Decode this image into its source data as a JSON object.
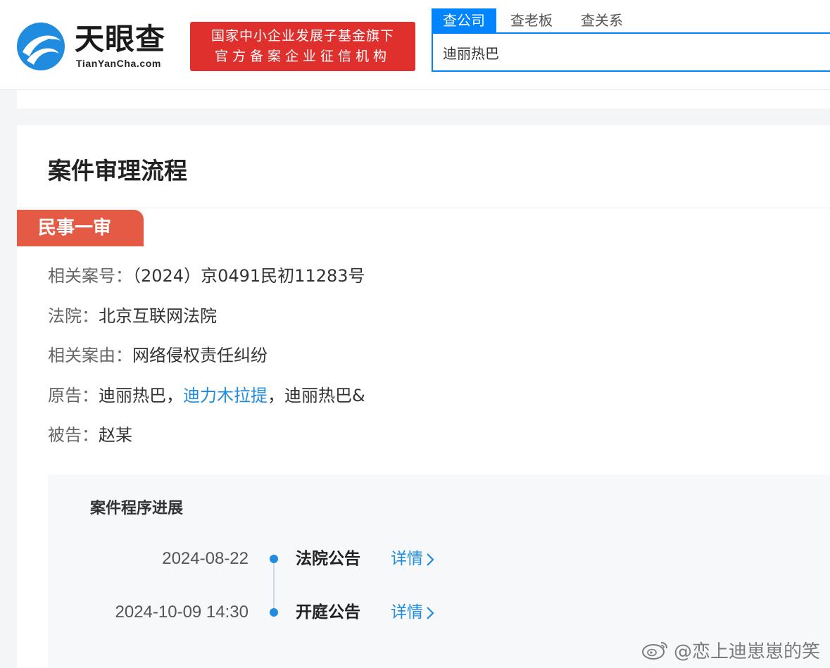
{
  "header": {
    "logo_name": "天眼查",
    "logo_domain": "TianYanCha.com",
    "badge_line1": "国家中小企业发展子基金旗下",
    "badge_line2": "官方备案企业征信机构",
    "tabs": [
      {
        "label": "查公司",
        "active": true
      },
      {
        "label": "查老板",
        "active": false
      },
      {
        "label": "查关系",
        "active": false
      }
    ],
    "search_value": "迪丽热巴",
    "accent_color": "#0084ff",
    "badge_color": "#e0302d"
  },
  "case": {
    "title": "案件审理流程",
    "stage": "民事一审",
    "stage_color": "#e45a45",
    "case_no_label": "相关案号：",
    "case_no": "（2024）京0491民初11283号",
    "court_label": "法院：",
    "court": "北京互联网法院",
    "cause_label": "相关案由：",
    "cause": "网络侵权责任纠纷",
    "plaintiff_label": "原告：",
    "plaintiffs": [
      {
        "name": "迪丽热巴",
        "sep": "，"
      },
      {
        "name": "迪力木拉提",
        "sep": "，"
      },
      {
        "name": "迪丽热巴&",
        "sep": ""
      }
    ],
    "defendant_label": "被告：",
    "defendant": "赵某"
  },
  "progress": {
    "title": "案件程序进展",
    "events": [
      {
        "date": "2024-08-22",
        "event": "法院公告",
        "detail": "详情"
      },
      {
        "date": "2024-10-09 14:30",
        "event": "开庭公告",
        "detail": "详情"
      }
    ]
  },
  "watermark": {
    "text": "@恋上迪崽崽的笑",
    "icon": "weibo-icon"
  }
}
